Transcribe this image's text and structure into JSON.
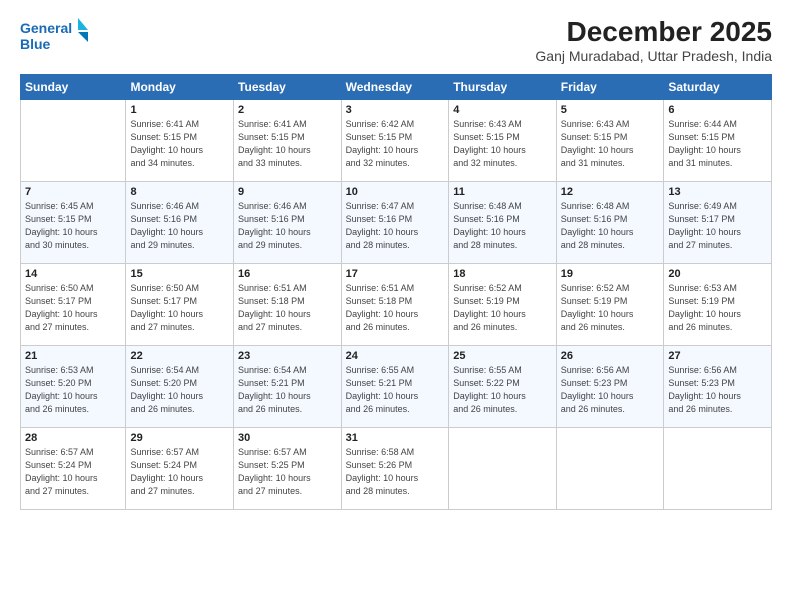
{
  "header": {
    "logo_line1": "General",
    "logo_line2": "Blue",
    "month": "December 2025",
    "location": "Ganj Muradabad, Uttar Pradesh, India"
  },
  "days_of_week": [
    "Sunday",
    "Monday",
    "Tuesday",
    "Wednesday",
    "Thursday",
    "Friday",
    "Saturday"
  ],
  "weeks": [
    [
      {
        "num": "",
        "info": ""
      },
      {
        "num": "1",
        "info": "Sunrise: 6:41 AM\nSunset: 5:15 PM\nDaylight: 10 hours\nand 34 minutes."
      },
      {
        "num": "2",
        "info": "Sunrise: 6:41 AM\nSunset: 5:15 PM\nDaylight: 10 hours\nand 33 minutes."
      },
      {
        "num": "3",
        "info": "Sunrise: 6:42 AM\nSunset: 5:15 PM\nDaylight: 10 hours\nand 32 minutes."
      },
      {
        "num": "4",
        "info": "Sunrise: 6:43 AM\nSunset: 5:15 PM\nDaylight: 10 hours\nand 32 minutes."
      },
      {
        "num": "5",
        "info": "Sunrise: 6:43 AM\nSunset: 5:15 PM\nDaylight: 10 hours\nand 31 minutes."
      },
      {
        "num": "6",
        "info": "Sunrise: 6:44 AM\nSunset: 5:15 PM\nDaylight: 10 hours\nand 31 minutes."
      }
    ],
    [
      {
        "num": "7",
        "info": "Sunrise: 6:45 AM\nSunset: 5:15 PM\nDaylight: 10 hours\nand 30 minutes."
      },
      {
        "num": "8",
        "info": "Sunrise: 6:46 AM\nSunset: 5:16 PM\nDaylight: 10 hours\nand 29 minutes."
      },
      {
        "num": "9",
        "info": "Sunrise: 6:46 AM\nSunset: 5:16 PM\nDaylight: 10 hours\nand 29 minutes."
      },
      {
        "num": "10",
        "info": "Sunrise: 6:47 AM\nSunset: 5:16 PM\nDaylight: 10 hours\nand 28 minutes."
      },
      {
        "num": "11",
        "info": "Sunrise: 6:48 AM\nSunset: 5:16 PM\nDaylight: 10 hours\nand 28 minutes."
      },
      {
        "num": "12",
        "info": "Sunrise: 6:48 AM\nSunset: 5:16 PM\nDaylight: 10 hours\nand 28 minutes."
      },
      {
        "num": "13",
        "info": "Sunrise: 6:49 AM\nSunset: 5:17 PM\nDaylight: 10 hours\nand 27 minutes."
      }
    ],
    [
      {
        "num": "14",
        "info": "Sunrise: 6:50 AM\nSunset: 5:17 PM\nDaylight: 10 hours\nand 27 minutes."
      },
      {
        "num": "15",
        "info": "Sunrise: 6:50 AM\nSunset: 5:17 PM\nDaylight: 10 hours\nand 27 minutes."
      },
      {
        "num": "16",
        "info": "Sunrise: 6:51 AM\nSunset: 5:18 PM\nDaylight: 10 hours\nand 27 minutes."
      },
      {
        "num": "17",
        "info": "Sunrise: 6:51 AM\nSunset: 5:18 PM\nDaylight: 10 hours\nand 26 minutes."
      },
      {
        "num": "18",
        "info": "Sunrise: 6:52 AM\nSunset: 5:19 PM\nDaylight: 10 hours\nand 26 minutes."
      },
      {
        "num": "19",
        "info": "Sunrise: 6:52 AM\nSunset: 5:19 PM\nDaylight: 10 hours\nand 26 minutes."
      },
      {
        "num": "20",
        "info": "Sunrise: 6:53 AM\nSunset: 5:19 PM\nDaylight: 10 hours\nand 26 minutes."
      }
    ],
    [
      {
        "num": "21",
        "info": "Sunrise: 6:53 AM\nSunset: 5:20 PM\nDaylight: 10 hours\nand 26 minutes."
      },
      {
        "num": "22",
        "info": "Sunrise: 6:54 AM\nSunset: 5:20 PM\nDaylight: 10 hours\nand 26 minutes."
      },
      {
        "num": "23",
        "info": "Sunrise: 6:54 AM\nSunset: 5:21 PM\nDaylight: 10 hours\nand 26 minutes."
      },
      {
        "num": "24",
        "info": "Sunrise: 6:55 AM\nSunset: 5:21 PM\nDaylight: 10 hours\nand 26 minutes."
      },
      {
        "num": "25",
        "info": "Sunrise: 6:55 AM\nSunset: 5:22 PM\nDaylight: 10 hours\nand 26 minutes."
      },
      {
        "num": "26",
        "info": "Sunrise: 6:56 AM\nSunset: 5:23 PM\nDaylight: 10 hours\nand 26 minutes."
      },
      {
        "num": "27",
        "info": "Sunrise: 6:56 AM\nSunset: 5:23 PM\nDaylight: 10 hours\nand 26 minutes."
      }
    ],
    [
      {
        "num": "28",
        "info": "Sunrise: 6:57 AM\nSunset: 5:24 PM\nDaylight: 10 hours\nand 27 minutes."
      },
      {
        "num": "29",
        "info": "Sunrise: 6:57 AM\nSunset: 5:24 PM\nDaylight: 10 hours\nand 27 minutes."
      },
      {
        "num": "30",
        "info": "Sunrise: 6:57 AM\nSunset: 5:25 PM\nDaylight: 10 hours\nand 27 minutes."
      },
      {
        "num": "31",
        "info": "Sunrise: 6:58 AM\nSunset: 5:26 PM\nDaylight: 10 hours\nand 28 minutes."
      },
      {
        "num": "",
        "info": ""
      },
      {
        "num": "",
        "info": ""
      },
      {
        "num": "",
        "info": ""
      }
    ]
  ]
}
